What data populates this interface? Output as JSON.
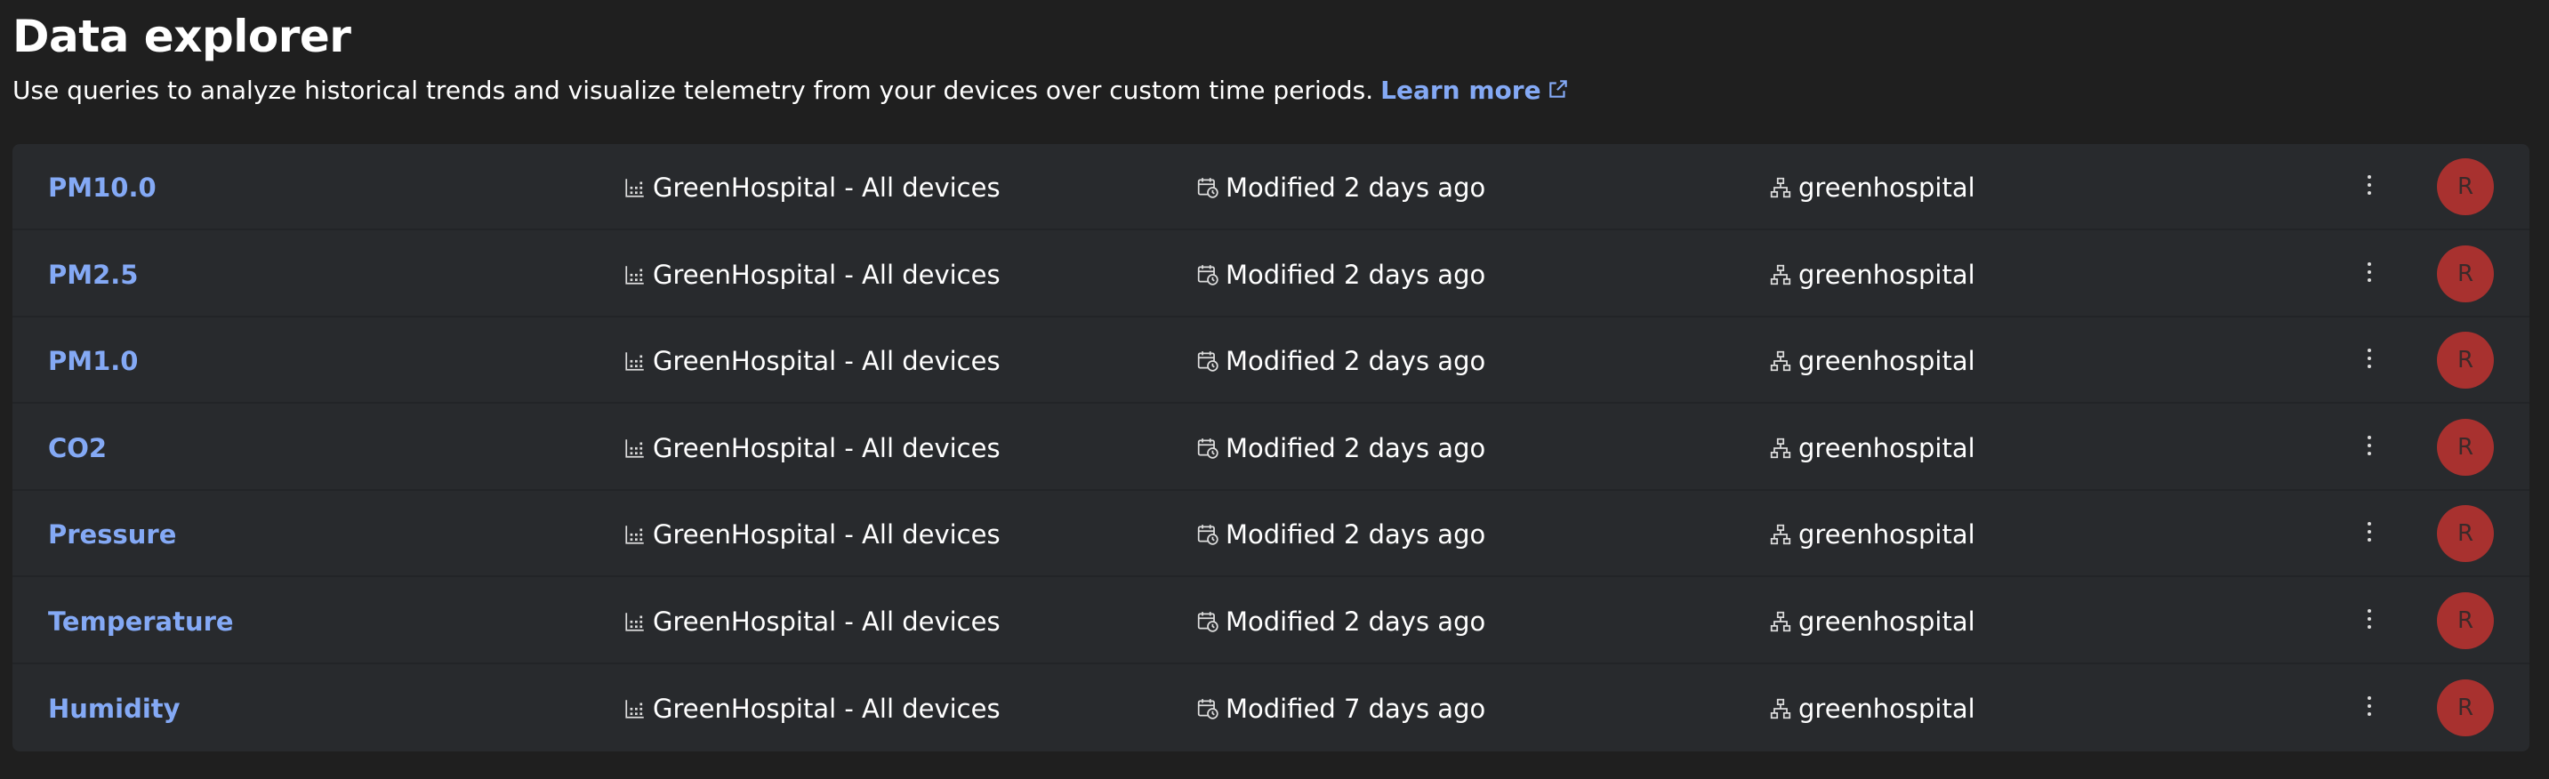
{
  "page": {
    "title": "Data explorer",
    "description": "Use queries to analyze historical trends and visualize telemetry from your devices over custom time periods.",
    "learn_more": "Learn more"
  },
  "icons": {
    "device": "device-group-icon",
    "modified": "calendar-clock-icon",
    "org": "organization-tree-icon",
    "menu": "more-vertical-icon",
    "external": "external-link-icon"
  },
  "colors": {
    "background": "#1f1f1f",
    "list_background": "#282a2d",
    "link": "#84a9f5",
    "avatar": "#a8312f"
  },
  "queries": [
    {
      "name": "PM10.0",
      "device": "GreenHospital - All devices",
      "modified": "Modified 2 days ago",
      "org": "greenhospital",
      "avatar": "R"
    },
    {
      "name": "PM2.5",
      "device": "GreenHospital - All devices",
      "modified": "Modified 2 days ago",
      "org": "greenhospital",
      "avatar": "R"
    },
    {
      "name": "PM1.0",
      "device": "GreenHospital - All devices",
      "modified": "Modified 2 days ago",
      "org": "greenhospital",
      "avatar": "R"
    },
    {
      "name": "CO2",
      "device": "GreenHospital - All devices",
      "modified": "Modified 2 days ago",
      "org": "greenhospital",
      "avatar": "R"
    },
    {
      "name": "Pressure",
      "device": "GreenHospital - All devices",
      "modified": "Modified 2 days ago",
      "org": "greenhospital",
      "avatar": "R"
    },
    {
      "name": "Temperature",
      "device": "GreenHospital - All devices",
      "modified": "Modified 2 days ago",
      "org": "greenhospital",
      "avatar": "R"
    },
    {
      "name": "Humidity",
      "device": "GreenHospital - All devices",
      "modified": "Modified 7 days ago",
      "org": "greenhospital",
      "avatar": "R"
    }
  ]
}
